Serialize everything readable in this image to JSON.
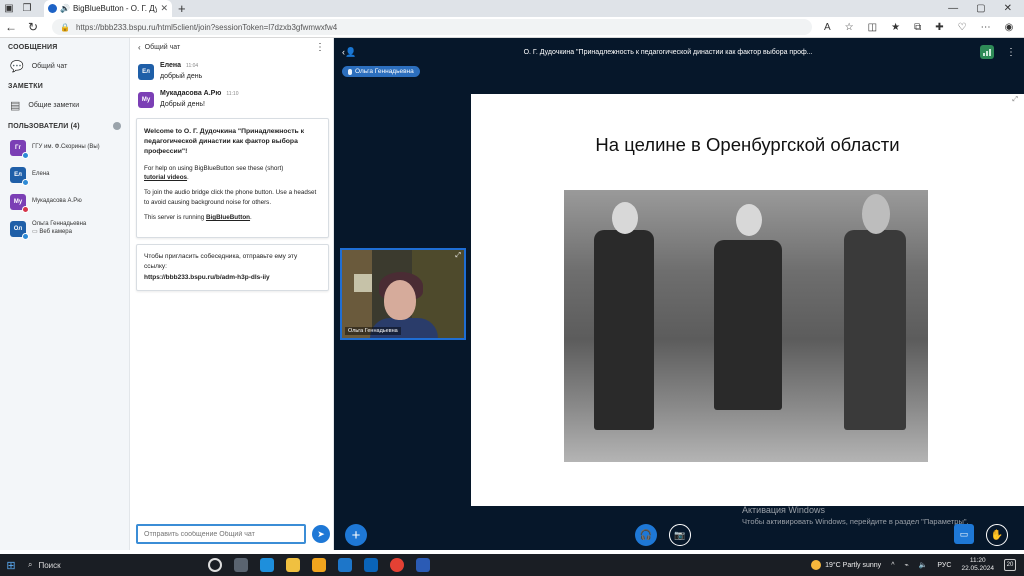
{
  "browser": {
    "tab_title": "BigBlueButton - О. Г. Дудочки",
    "url": "https://bbb233.bspu.ru/html5client/join?sessionToken=l7dzxb3gfwmwxfw4"
  },
  "sidebar": {
    "messages_title": "СООБЩЕНИЯ",
    "public_chat": "Общий чат",
    "notes_title": "ЗАМЕТКИ",
    "shared_notes": "Общие заметки",
    "users_title": "ПОЛЬЗОВАТЕЛИ (4)",
    "users": [
      {
        "initials": "Гг",
        "name": "ГГУ им. Ф.Скорины (Вы)",
        "sub": "",
        "color": "#7b3fb5",
        "status_color": "#2e8bd6"
      },
      {
        "initials": "Ел",
        "name": "Елена",
        "sub": "",
        "color": "#1f5fa8",
        "status_color": "#2e8bd6"
      },
      {
        "initials": "Му",
        "name": "Мукадасова А.Рю",
        "sub": "",
        "color": "#7b3fb5",
        "status_color": "#d6344a"
      },
      {
        "initials": "Ол",
        "name": "Ольга Геннадьевна",
        "sub": "Веб камера",
        "color": "#1f5fa8",
        "status_color": "#2e8bd6"
      }
    ]
  },
  "chat": {
    "header": "Общий чат",
    "messages": [
      {
        "initials": "Ел",
        "name": "Елена",
        "time": "11:04",
        "text": "добрый день",
        "color": "#1f5fa8"
      },
      {
        "initials": "Му",
        "name": "Мукадасова А.Рю",
        "time": "11:10",
        "text": "Добрый день!",
        "color": "#7b3fb5"
      }
    ],
    "welcome": {
      "prefix": "Welcome to ",
      "title": "О. Г. Дудочкина \"Принадлежность к педагогической династии как фактор выбора профессии\"",
      "suffix": "!",
      "help_prefix": "For help on using BigBlueButton see these (short)",
      "help_link": "tutorial videos",
      "audio": "To join the audio bridge click the phone button. Use a headset to avoid causing background noise for others.",
      "server_prefix": "This server is running ",
      "server_link": "BigBlueButton"
    },
    "invite_text": "Чтобы пригласить собеседника, отправьте ему эту ссылку:",
    "invite_link": "https://bbb233.bspu.ru/b/adm-h3p-dls-iiy",
    "input_placeholder": "Отправить сообщение Общий чат"
  },
  "main": {
    "title": "О. Г. Дудочкина \"Принадлежность к педагогической династии как фактор выбора проф...",
    "talker": "Ольга Геннадьевна",
    "webcam_label": "Ольга Геннадьевна",
    "slide_title": "На целине в Оренбургской области",
    "activation_title": "Активация Windows",
    "activation_sub": "Чтобы активировать Windows, перейдите в раздел \"Параметры\"."
  },
  "taskbar": {
    "search": "Поиск",
    "weather": "19°C  Partly sunny",
    "lang": "РУС",
    "time": "11:20",
    "date": "22.05.2024",
    "notif_count": "20"
  }
}
